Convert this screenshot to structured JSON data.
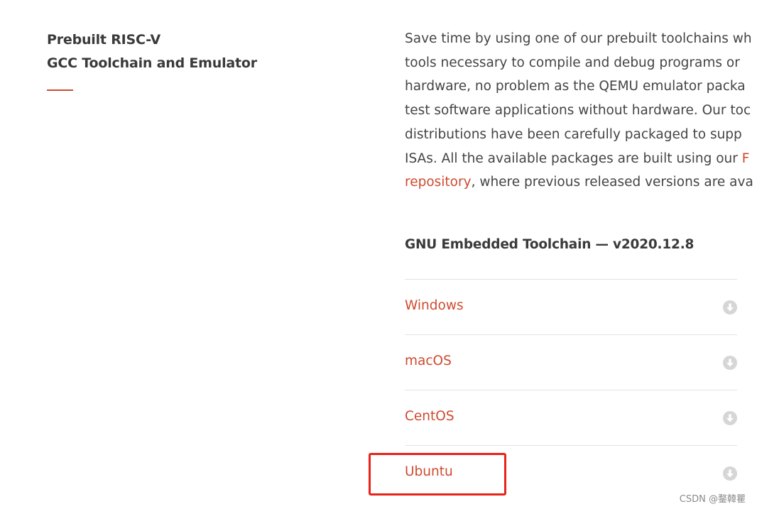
{
  "sidebar": {
    "title_line1": "Prebuilt RISC-V",
    "title_line2": "GCC Toolchain and Emulator"
  },
  "intro": {
    "line1": "Save time by using one of our prebuilt toolchains wh",
    "line2": "tools necessary to compile and debug programs or",
    "line3": "hardware, no problem as the QEMU emulator packa",
    "line4": "test software applications without hardware. Our toc",
    "line5": "distributions have been carefully packaged to supp",
    "line6_text": "ISAs. All the available packages are built using our ",
    "line6_link": "F",
    "line7_link": "repository",
    "line7_text": ", where previous released versions are ava"
  },
  "toolchain": {
    "heading": "GNU Embedded Toolchain — v2020.12.8",
    "downloads": [
      {
        "label": "Windows",
        "icon": "download-circle-icon"
      },
      {
        "label": "macOS",
        "icon": "download-circle-icon"
      },
      {
        "label": "CentOS",
        "icon": "download-circle-icon"
      },
      {
        "label": "Ubuntu",
        "icon": "download-circle-icon"
      }
    ]
  },
  "watermark": "CSDN @鍪韓瞿",
  "colors": {
    "accent": "#cf4a2f",
    "highlight": "#e8231a",
    "icon_gray": "#d6d6d6"
  }
}
